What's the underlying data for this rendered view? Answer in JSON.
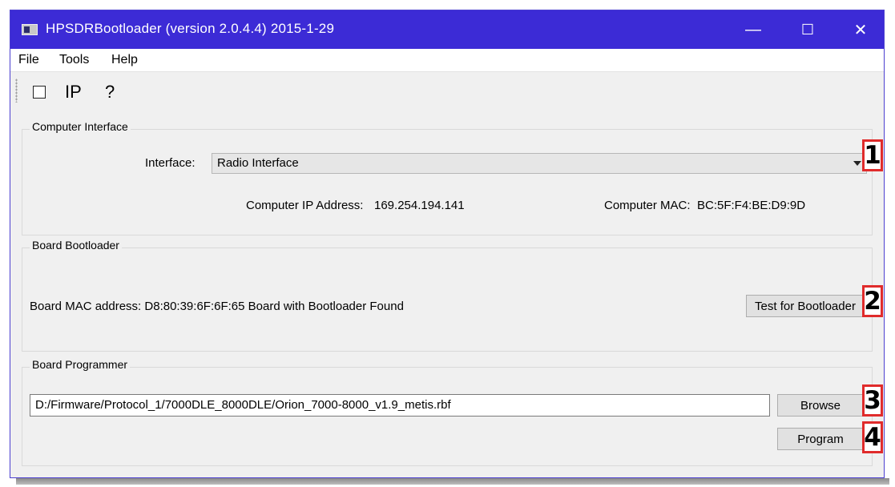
{
  "window": {
    "title": "HPSDRBootloader (version 2.0.4.4) 2015-1-29",
    "minimize": "—",
    "maximize": "☐",
    "close": "✕"
  },
  "menu": {
    "file": "File",
    "tools": "Tools",
    "help": "Help"
  },
  "toolbar": {
    "ip": "IP",
    "help": "?"
  },
  "computer_interface": {
    "title": "Computer Interface",
    "interface_label": "Interface:",
    "interface_value": "Radio Interface",
    "ip_label": "Computer IP Address:",
    "ip_value": "169.254.194.141",
    "mac_label": "Computer MAC:",
    "mac_value": "BC:5F:F4:BE:D9:9D"
  },
  "board_bootloader": {
    "title": "Board Bootloader",
    "status": "Board MAC address:  D8:80:39:6F:6F:65  Board with Bootloader Found",
    "test_button": "Test for Bootloader"
  },
  "board_programmer": {
    "title": "Board Programmer",
    "file_path": "D:/Firmware/Protocol_1/7000DLE_8000DLE/Orion_7000-8000_v1.9_metis.rbf",
    "browse_button": "Browse",
    "program_button": "Program"
  },
  "annotations": [
    "1",
    "2",
    "3",
    "4"
  ],
  "colors": {
    "titlebar": "#3c2bd6",
    "marker_border": "#e02b2b",
    "window_bg": "#f0f0f0"
  }
}
